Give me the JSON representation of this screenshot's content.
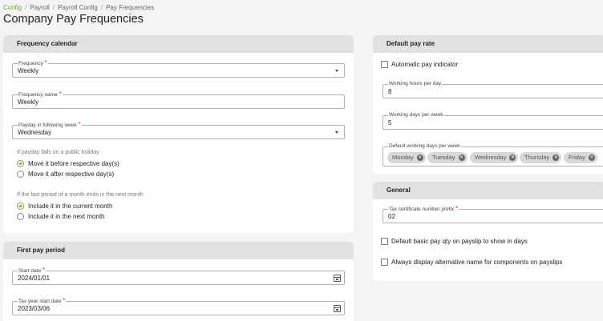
{
  "breadcrumb": [
    "Config",
    "Payroll",
    "Payroll Config",
    "Pay Frequencies"
  ],
  "page_title": "Company Pay Frequencies",
  "frequency_calendar": {
    "title": "Frequency calendar",
    "frequency": {
      "label": "Frequency",
      "value": "Weekly"
    },
    "frequency_name": {
      "label": "Frequency name",
      "value": "Weekly"
    },
    "payday": {
      "label": "Payday in following week",
      "value": "Wednesday"
    },
    "holiday_hint": "If payday falls on a public holiday",
    "holiday_options": [
      "Move it before respective day(s)",
      "Move it after respective day(s)"
    ],
    "period_hint": "If the last period of a month ends in the next month",
    "period_options": [
      "Include it in the current month",
      "Include it in the next month"
    ]
  },
  "first_pay_period": {
    "title": "First pay period",
    "start_date": {
      "label": "Start date",
      "value": "2024/01/01"
    },
    "tax_year_start": {
      "label": "Tax year start date",
      "value": "2023/03/06"
    }
  },
  "default_pay_rate": {
    "title": "Default pay rate",
    "auto_indicator": "Automatic pay indicator",
    "working_hours": {
      "label": "Working hours per day",
      "value": "8"
    },
    "working_days": {
      "label": "Working days per week",
      "value": "5"
    },
    "default_days": {
      "label": "Default working days per week",
      "chips": [
        "Monday",
        "Tuesday",
        "Wednesday",
        "Thursday",
        "Friday"
      ]
    }
  },
  "general": {
    "title": "General",
    "tax_prefix": {
      "label": "Tax certificate number prefix",
      "value": "02"
    },
    "basic_pay_days": "Default basic pay qty on payslip to show in days",
    "alt_name": "Always display alternative name for components on payslips"
  },
  "colors": {
    "accent": "#6aa83a",
    "required": "#e03030",
    "card_header": "#e2e2e2",
    "background": "#f4f4f4"
  }
}
